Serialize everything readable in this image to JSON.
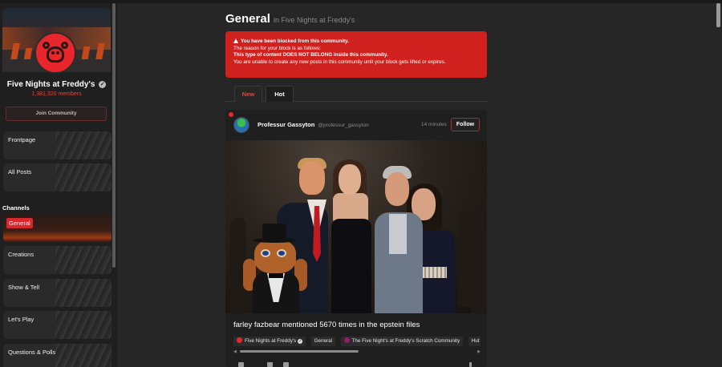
{
  "sidebar": {
    "community_name": "Five Nights at Freddy's",
    "members": "1,381,320 members",
    "join_label": "Join Community",
    "nav": [
      {
        "label": "Frontpage"
      },
      {
        "label": "All Posts"
      }
    ],
    "channels_heading": "Channels",
    "channels": [
      {
        "label": "General",
        "active": true
      },
      {
        "label": "Creations"
      },
      {
        "label": "Show & Tell"
      },
      {
        "label": "Let's Play"
      },
      {
        "label": "Questions & Polls"
      }
    ]
  },
  "header": {
    "title": "General",
    "subtitle": "in Five Nights at Freddy's"
  },
  "alert": {
    "heading": "You have been blocked from this community.",
    "line2": "The reason for your block is as follows:",
    "reason": "This type of content DOES NOT BELONG inside this community.",
    "line4": "You are unable to create any new posts in this community until your block gets lifted or expires."
  },
  "tabs": [
    {
      "label": "New",
      "active": true
    },
    {
      "label": "Hot",
      "active": false
    }
  ],
  "post": {
    "author": "Professur Gassyton",
    "handle": "@professur_gassyton",
    "time": "14 minutes",
    "follow_label": "Follow",
    "title": "farley fazbear mentioned 5670 times in the epstein files",
    "chips": [
      {
        "label": "Five Nights at Freddy's"
      },
      {
        "label": "General"
      },
      {
        "label": "The Five Night's at Freddy's Scratch Community"
      },
      {
        "label": "Hut"
      }
    ]
  },
  "colors": {
    "accent": "#e8262b",
    "alert_bg": "#d0211f",
    "background": "#262626"
  }
}
